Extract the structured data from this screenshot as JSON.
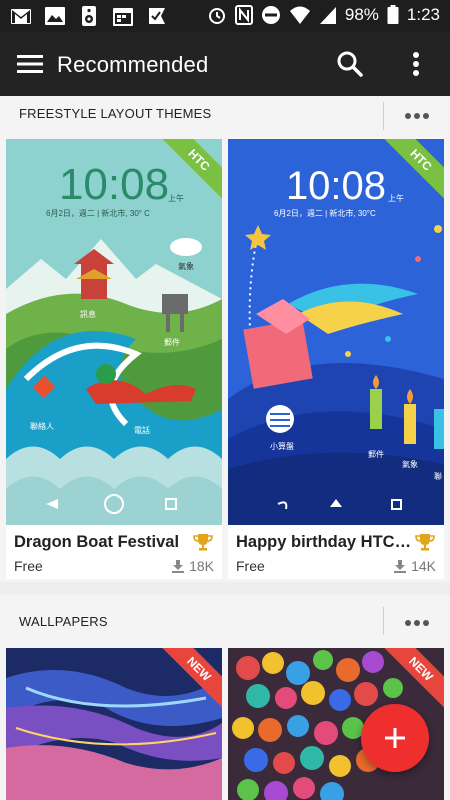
{
  "status_bar": {
    "left_icons": [
      "gmail-icon",
      "photo-icon",
      "speaker-icon",
      "calendar-icon",
      "check-flag-icon"
    ],
    "right_icons": [
      "alarm-icon",
      "nfc-icon",
      "do-not-disturb-icon",
      "wifi-icon",
      "signal-icon",
      "battery-icon"
    ],
    "battery": "98%",
    "time": "1:23"
  },
  "appbar": {
    "title": "Recommended",
    "icons": [
      "menu-icon",
      "search-icon",
      "more-vert-icon"
    ]
  },
  "sections": {
    "themes": {
      "title": "FREESTYLE LAYOUT THEMES",
      "cards": [
        {
          "name": "Dragon Boat Festival",
          "price": "Free",
          "downloads": "18K",
          "badge": "HTC",
          "preview": {
            "time": "10:08",
            "ampm": "上午",
            "date": "6月2日，週二 | 新北市, 30° C",
            "labels": [
              "氣象",
              "訊息",
              "郵件",
              "聯絡人",
              "電話"
            ]
          }
        },
        {
          "name": "Happy birthday HTC theme",
          "price": "Free",
          "downloads": "14K",
          "badge": "HTC",
          "preview": {
            "time": "10:08",
            "ampm": "上午",
            "date": "6月2日，週二 | 新北市, 30°C",
            "labels": [
              "小算盤",
              "郵件",
              "氣象",
              "聯"
            ]
          }
        }
      ]
    },
    "wallpapers": {
      "title": "WALLPAPERS",
      "cards": [
        {
          "badge": "NEW"
        },
        {
          "badge": "NEW"
        }
      ]
    }
  },
  "fab": {
    "icon": "plus-icon"
  },
  "colors": {
    "appbar": "#232323",
    "statusbar": "#1e1e1e",
    "fab": "#ef2e2e",
    "htc_ribbon": "#7ac143",
    "new_ribbon": "#e8453c",
    "trophy": "#e0a51c"
  }
}
